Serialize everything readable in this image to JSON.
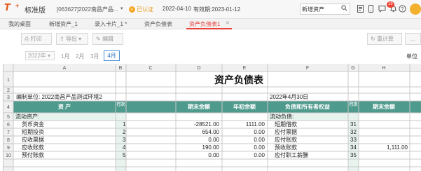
{
  "header": {
    "logo": "T",
    "logo_plus": "+",
    "edition": "标准版",
    "account": "[063627]2022南昌产品...",
    "certified": "已认证",
    "date": "2022-04-10",
    "expiry": "有效期:2023-01-12",
    "search_value": "新增资产",
    "notification_count": "19",
    "icons": [
      "search-icon",
      "document-icon",
      "phone-icon",
      "chat-icon",
      "bell-icon",
      "help-icon",
      "settings-icon"
    ]
  },
  "tabs": [
    {
      "label": "我的桌面"
    },
    {
      "label": "新增资产_1"
    },
    {
      "label": "录入卡片_1 *"
    },
    {
      "label": "资产负债表"
    },
    {
      "label": "资产负债表1"
    }
  ],
  "tab_close": "✕",
  "toolbar": {
    "print": "打印",
    "export": "导出",
    "edit": "编辑",
    "recalc": "重计算",
    "more": "..."
  },
  "period": {
    "year": "2022年",
    "months": [
      "1月",
      "2月",
      "3月",
      "4月"
    ],
    "active_month": "4月",
    "unit_label": "单位"
  },
  "sheet": {
    "col_headers": [
      "A",
      "B",
      "C",
      "D",
      "E",
      "F",
      "G",
      "H"
    ],
    "row_numbers": [
      "1",
      "2",
      "3",
      "4",
      "5",
      "6",
      "7",
      "8",
      "9",
      "10"
    ],
    "title": "资产负债表",
    "company": "编制单位: 2022南昌产品测试环境2",
    "report_date": "2022年4月30日",
    "table_headers": {
      "assets": "资    产",
      "line": "行次",
      "end_balance": "期末余额",
      "begin_balance": "年初余额",
      "liabilities": "负债和所有者权益",
      "line2": "行次",
      "end_balance2": "期末余额"
    },
    "section_assets": "流动资产:",
    "section_liabilities": "流动负债:",
    "rows": [
      {
        "asset": "货币资金",
        "line": "1",
        "end": "-28521.00",
        "begin": "1111.00",
        "liab": "短期借款",
        "line2": "31",
        "end2": ""
      },
      {
        "asset": "短期投资",
        "line": "2",
        "end": "654.00",
        "begin": "0.00",
        "liab": "应付票据",
        "line2": "32",
        "end2": ""
      },
      {
        "asset": "应收票据",
        "line": "3",
        "end": "0.00",
        "begin": "0.00",
        "liab": "应付账款",
        "line2": "33",
        "end2": ""
      },
      {
        "asset": "应收账款",
        "line": "4",
        "end": "190.00",
        "begin": "0.00",
        "liab": "预收账款",
        "line2": "34",
        "end2": "1,111.00"
      },
      {
        "asset": "预付账款",
        "line": "5",
        "end": "0.00",
        "begin": "0.00",
        "liab": "应付职工薪酬",
        "line2": "35",
        "end2": ""
      }
    ]
  }
}
